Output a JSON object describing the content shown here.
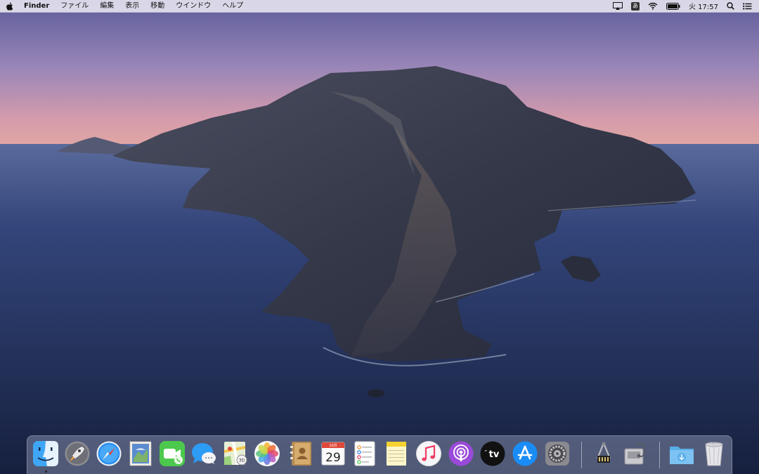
{
  "menubar": {
    "app_name": "Finder",
    "items": [
      "ファイル",
      "編集",
      "表示",
      "移動",
      "ウインドウ",
      "ヘルプ"
    ],
    "ime_label": "あ",
    "clock": "火 17:57"
  },
  "dock": {
    "apps": [
      {
        "name": "Finder",
        "icon": "finder-icon",
        "running": true
      },
      {
        "name": "Launchpad",
        "icon": "launchpad-icon"
      },
      {
        "name": "Safari",
        "icon": "safari-icon"
      },
      {
        "name": "Mail",
        "icon": "mail-icon"
      },
      {
        "name": "FaceTime",
        "icon": "facetime-icon"
      },
      {
        "name": "Messages",
        "icon": "messages-icon"
      },
      {
        "name": "Maps",
        "icon": "maps-icon"
      },
      {
        "name": "Photos",
        "icon": "photos-icon"
      },
      {
        "name": "Contacts",
        "icon": "contacts-icon"
      },
      {
        "name": "Calendar",
        "icon": "calendar-icon",
        "month": "10月",
        "day": "29"
      },
      {
        "name": "Reminders",
        "icon": "reminders-icon"
      },
      {
        "name": "Notes",
        "icon": "notes-icon"
      },
      {
        "name": "Music",
        "icon": "music-icon"
      },
      {
        "name": "Podcasts",
        "icon": "podcasts-icon"
      },
      {
        "name": "TV",
        "icon": "tv-icon",
        "label": "tv"
      },
      {
        "name": "App Store",
        "icon": "app-store-icon"
      },
      {
        "name": "System Preferences",
        "icon": "system-preferences-icon"
      },
      {
        "name": "System Information",
        "icon": "system-information-icon"
      },
      {
        "name": "Disk Utility",
        "icon": "disk-utility-icon"
      },
      {
        "name": "Downloads",
        "icon": "downloads-folder-icon"
      },
      {
        "name": "Trash",
        "icon": "trash-icon"
      }
    ]
  },
  "colors": {
    "accent": "#1a7cf0",
    "sky_top": "#7a6aa6",
    "sea": "#263660"
  }
}
